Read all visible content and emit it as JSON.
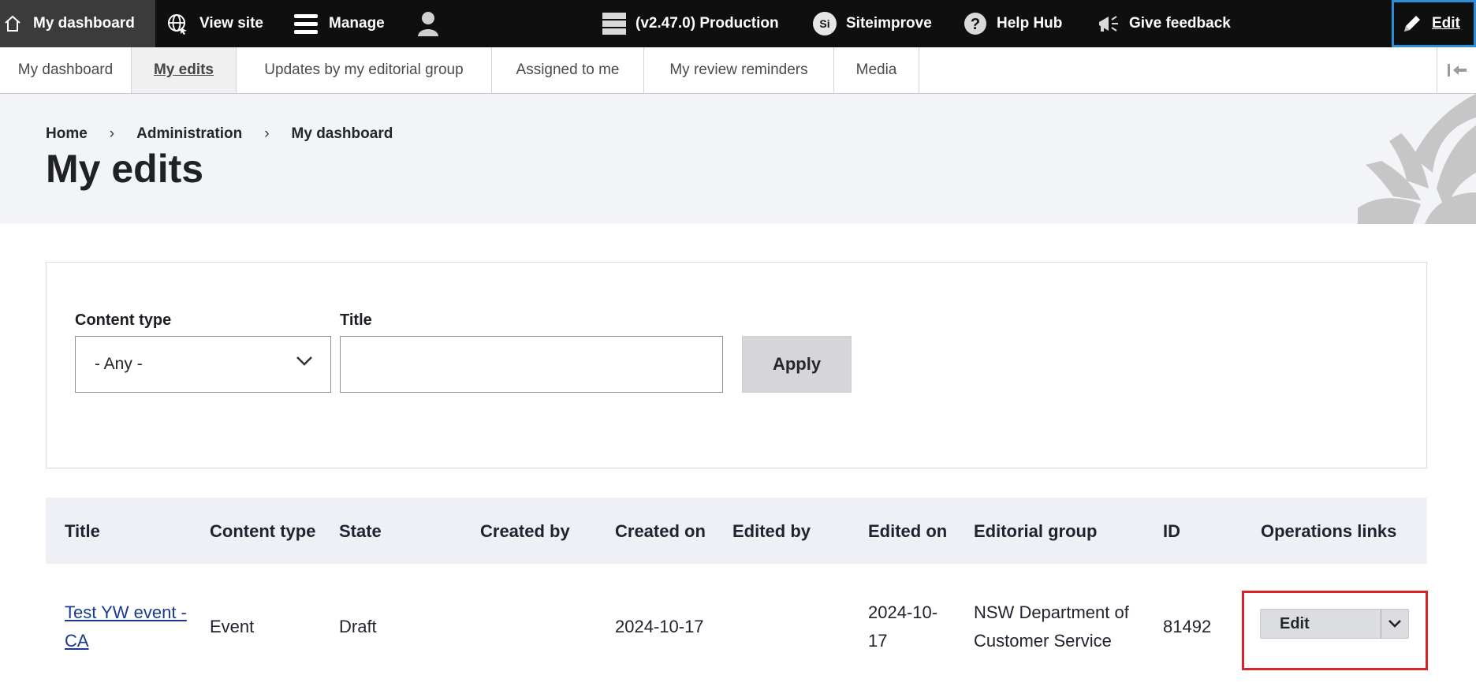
{
  "toolbar": {
    "home_label": "My dashboard",
    "view_site_label": "View site",
    "manage_label": "Manage",
    "environment_label": "(v2.47.0) Production",
    "siteimprove_badge": "Si",
    "siteimprove_label": "Siteimprove",
    "help_label": "Help Hub",
    "feedback_label": "Give feedback",
    "edit_label": "Edit"
  },
  "tray": {
    "tabs": [
      {
        "label": "My dashboard"
      },
      {
        "label": "My edits"
      },
      {
        "label": "Updates by my editorial group"
      },
      {
        "label": "Assigned to me"
      },
      {
        "label": "My review reminders"
      },
      {
        "label": "Media"
      }
    ],
    "active_tab": "My edits"
  },
  "breadcrumb": [
    "Home",
    "Administration",
    "My dashboard"
  ],
  "page_title": "My edits",
  "filters": {
    "content_type_label": "Content type",
    "content_type_value": "- Any -",
    "title_label": "Title",
    "title_value": "",
    "apply_label": "Apply"
  },
  "table": {
    "headers": [
      "Title",
      "Content type",
      "State",
      "Created by",
      "Created on",
      "Edited by",
      "Edited on",
      "Editorial group",
      "ID",
      "Operations links"
    ],
    "rows": [
      {
        "title": "Test YW event - CA",
        "content_type": "Event",
        "state": "Draft",
        "created_by": "",
        "created_on": "2024-10-17",
        "edited_by": "",
        "edited_on": "2024-10-17",
        "editorial_group": "NSW Department of Customer Service",
        "id": "81492",
        "operation_label": "Edit"
      }
    ]
  },
  "colors": {
    "toolbar_bg": "#0f0f0f",
    "header_bg": "#f3f4f7",
    "table_header_bg": "#eef0f5",
    "highlight": "#d8232a",
    "focus_outline": "#2a8fd6",
    "link": "#1a3b8a"
  },
  "icons": {
    "home": "home-icon",
    "view_site": "globe-icon",
    "manage": "menu-icon",
    "user": "user-icon",
    "environment": "server-icon",
    "help": "question-circle-icon",
    "feedback": "megaphone-icon",
    "edit": "pencil-icon",
    "tray_collapse": "collapse-left-icon",
    "select_chevron": "chevron-down-icon",
    "dropbutton_toggle": "chevron-down-icon"
  }
}
